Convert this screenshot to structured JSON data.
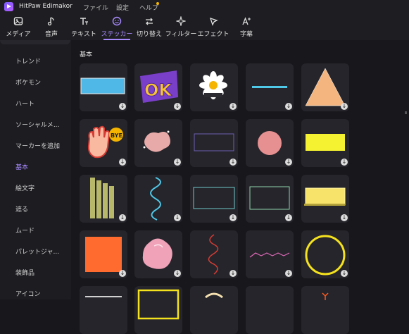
{
  "window": {
    "title": "HitPaw Edimakor",
    "menus": [
      "ファイル",
      "設定",
      "ヘルプ"
    ]
  },
  "toolbar": {
    "tabs": [
      {
        "label": "メディア",
        "icon": "media-icon"
      },
      {
        "label": "音声",
        "icon": "music-note-icon"
      },
      {
        "label": "テキスト",
        "icon": "text-icon"
      },
      {
        "label": "ステッカー",
        "icon": "sticker-icon",
        "active": true
      },
      {
        "label": "切り替え",
        "icon": "transition-icon"
      },
      {
        "label": "フィルター",
        "icon": "filter-sparkle-icon"
      },
      {
        "label": "エフェクト",
        "icon": "effect-icon"
      },
      {
        "label": "字幕",
        "icon": "subtitle-icon"
      }
    ]
  },
  "sidebar": {
    "items": [
      {
        "label": "トレンド"
      },
      {
        "label": "ポケモン"
      },
      {
        "label": "ハート"
      },
      {
        "label": "ソーシャルメ..."
      },
      {
        "label": "マーカーを追加"
      },
      {
        "label": "基本",
        "active": true
      },
      {
        "label": "絵文字"
      },
      {
        "label": "遮る"
      },
      {
        "label": "ムード"
      },
      {
        "label": "パレットジャ..."
      },
      {
        "label": "装飾品"
      },
      {
        "label": "アイコン"
      }
    ]
  },
  "content": {
    "section_title": "基本",
    "download_glyph": "↓",
    "ok_sticker_text": "OK",
    "bye_sticker_text": "BYE",
    "colors": {
      "accent": "#a98bff",
      "cyan": "#4fb8e6",
      "orange": "#ff6a2e",
      "yellow": "#f5f232",
      "peach": "#f4b57e",
      "pink": "#f0a2b8"
    }
  }
}
